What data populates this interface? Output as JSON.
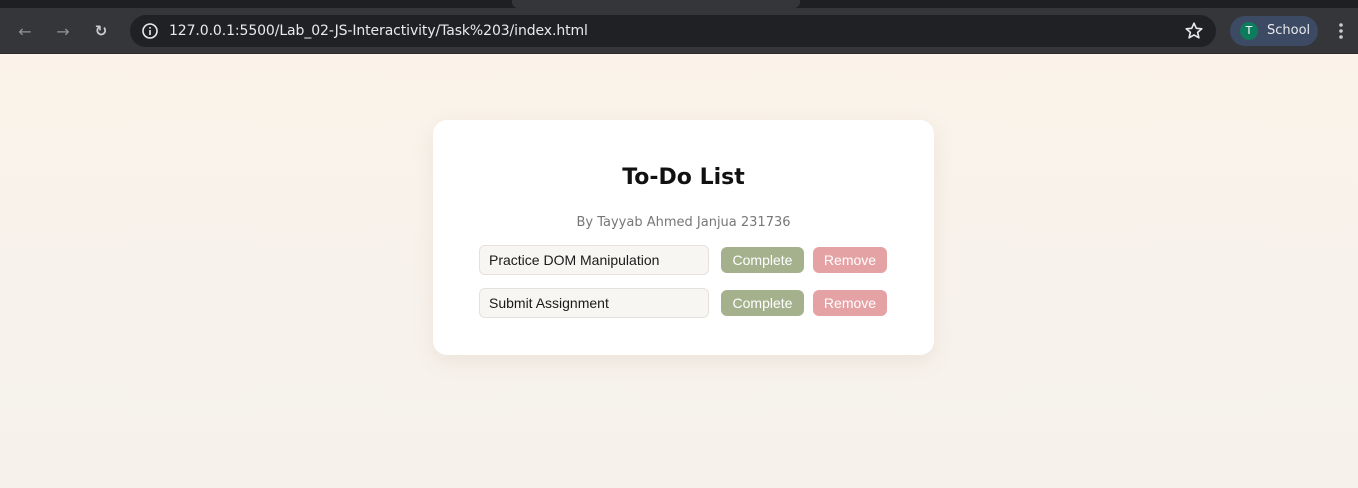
{
  "browser": {
    "url": "127.0.0.1:5500/Lab_02-JS-Interactivity/Task%203/index.html",
    "profile": {
      "initial": "T",
      "name": "School"
    },
    "icons": [
      "back-icon",
      "forward-icon",
      "reload-icon",
      "info-icon",
      "star-icon",
      "menu-icon"
    ]
  },
  "page": {
    "title": "To-Do List",
    "subtitle": "By Tayyab Ahmed Janjua 231736",
    "tasks": [
      {
        "text": "Practice DOM Manipulation",
        "complete_label": "Complete",
        "remove_label": "Remove"
      },
      {
        "text": "Submit Assignment",
        "complete_label": "Complete",
        "remove_label": "Remove"
      }
    ]
  },
  "colors": {
    "complete_button": "#a4b18c",
    "remove_button": "#e5a2a5",
    "page_background": "#f7f2ec",
    "card_background": "#ffffff"
  }
}
